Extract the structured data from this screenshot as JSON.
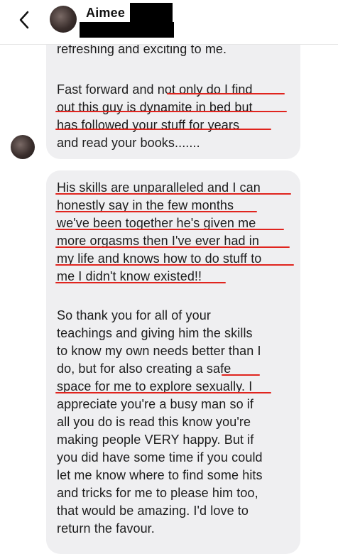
{
  "header": {
    "contact_name": "Aimee",
    "back_icon": "chevron-left-icon"
  },
  "messages": {
    "bubble1": {
      "lines": [
        "refreshing and exciting to me.",
        "",
        "Fast forward and not only do I find",
        "out this guy is dynamite in bed but",
        "has followed your stuff for years",
        "and read your books......."
      ]
    },
    "bubble2": {
      "lines": [
        "His skills are unparalleled and I can",
        "honestly say in the few months",
        "we've been together he's given me",
        "more orgasms then I've ever had in",
        "my life and knows how to do stuff to",
        "me I didn't know existed!!",
        "",
        "So thank you for all of your",
        "teachings and giving him the skills",
        "to know my own needs better than I",
        "do, but for also creating a safe",
        "space for me to explore sexually. I",
        "appreciate you're a busy man so if",
        "all you do is read this know you're",
        "making people VERY happy. But if",
        "you did have some time if you could",
        "let me know where to find some hits",
        "and tricks for me to please him too,",
        "that would be amazing. I'd love to",
        "return the favour."
      ]
    }
  },
  "colors": {
    "bubble": "#efeff1",
    "underline": "#e0241e",
    "redaction": "#000000"
  }
}
